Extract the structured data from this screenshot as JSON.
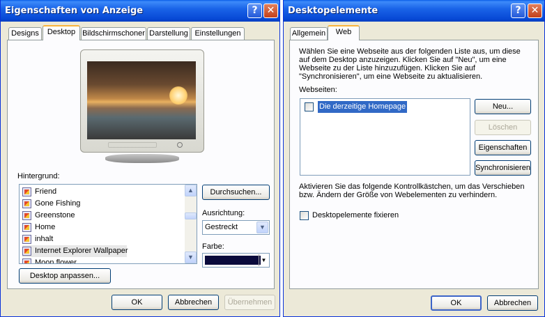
{
  "left": {
    "title": "Eigenschaften von Anzeige",
    "help": "?",
    "close": "✕",
    "tabs": [
      "Designs",
      "Desktop",
      "Bildschirmschoner",
      "Darstellung",
      "Einstellungen"
    ],
    "background_label": "Hintergrund:",
    "backgrounds": [
      "Friend",
      "Gone Fishing",
      "Greenstone",
      "Home",
      "inhalt",
      "Internet Explorer Wallpaper",
      "Moon flower"
    ],
    "browse": "Durchsuchen...",
    "position_label": "Ausrichtung:",
    "position_value": "Gestreckt",
    "color_label": "Farbe:",
    "color_value": "#0a0a3c",
    "customize": "Desktop anpassen...",
    "ok": "OK",
    "cancel": "Abbrechen",
    "apply": "Übernehmen"
  },
  "right": {
    "title": "Desktopelemente",
    "help": "?",
    "close": "✕",
    "tabs": [
      "Allgemein",
      "Web"
    ],
    "intro": "Wählen Sie eine Webseite aus der folgenden Liste aus, um diese auf dem Desktop anzuzeigen. Klicken Sie auf \"Neu\", um eine Webseite zu der Liste hinzuzufügen. Klicken Sie auf \"Synchronisieren\", um eine Webseite zu aktualisieren.",
    "webpages_label": "Webseiten:",
    "webpage_item": "Die derzeitige Homepage",
    "new": "Neu...",
    "delete": "Löschen",
    "properties": "Eigenschaften",
    "sync": "Synchronisieren",
    "lock_info": "Aktivieren Sie das folgende Kontrollkästchen, um das Verschieben bzw. Ändern der Größe von Webelementen zu verhindern.",
    "lock_label": "Desktopelemente fixieren",
    "ok": "OK",
    "cancel": "Abbrechen"
  }
}
